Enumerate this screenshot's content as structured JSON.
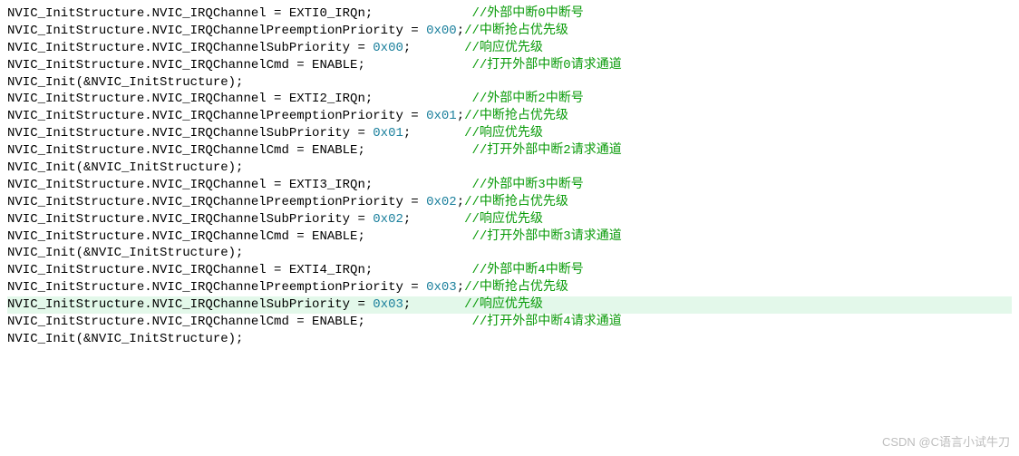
{
  "lines": [
    {
      "code": "NVIC_InitStructure.NVIC_IRQChannel = EXTI0_IRQn;             ",
      "comment": "//外部中断0中断号"
    },
    {
      "code": "NVIC_InitStructure.NVIC_IRQChannelPreemptionPriority = ",
      "num": "0x00",
      "tail": ";",
      "comment": "//中断抢占优先级"
    },
    {
      "code": "NVIC_InitStructure.NVIC_IRQChannelSubPriority = ",
      "num": "0x00",
      "tail": ";       ",
      "comment": "//响应优先级"
    },
    {
      "code": "NVIC_InitStructure.NVIC_IRQChannelCmd = ENABLE;              ",
      "comment": "//打开外部中断0请求通道"
    },
    {
      "code": "NVIC_Init(&NVIC_InitStructure);"
    },
    {
      "code": ""
    },
    {
      "code": "NVIC_InitStructure.NVIC_IRQChannel = EXTI2_IRQn;             ",
      "comment": "//外部中断2中断号"
    },
    {
      "code": "NVIC_InitStructure.NVIC_IRQChannelPreemptionPriority = ",
      "num": "0x01",
      "tail": ";",
      "comment": "//中断抢占优先级"
    },
    {
      "code": "NVIC_InitStructure.NVIC_IRQChannelSubPriority = ",
      "num": "0x01",
      "tail": ";       ",
      "comment": "//响应优先级"
    },
    {
      "code": "NVIC_InitStructure.NVIC_IRQChannelCmd = ENABLE;              ",
      "comment": "//打开外部中断2请求通道"
    },
    {
      "code": "NVIC_Init(&NVIC_InitStructure);"
    },
    {
      "code": ""
    },
    {
      "code": ""
    },
    {
      "code": "NVIC_InitStructure.NVIC_IRQChannel = EXTI3_IRQn;             ",
      "comment": "//外部中断3中断号"
    },
    {
      "code": "NVIC_InitStructure.NVIC_IRQChannelPreemptionPriority = ",
      "num": "0x02",
      "tail": ";",
      "comment": "//中断抢占优先级"
    },
    {
      "code": "NVIC_InitStructure.NVIC_IRQChannelSubPriority = ",
      "num": "0x02",
      "tail": ";       ",
      "comment": "//响应优先级"
    },
    {
      "code": "NVIC_InitStructure.NVIC_IRQChannelCmd = ENABLE;              ",
      "comment": "//打开外部中断3请求通道"
    },
    {
      "code": "NVIC_Init(&NVIC_InitStructure);"
    },
    {
      "code": ""
    },
    {
      "code": "NVIC_InitStructure.NVIC_IRQChannel = EXTI4_IRQn;             ",
      "comment": "//外部中断4中断号"
    },
    {
      "code": "NVIC_InitStructure.NVIC_IRQChannelPreemptionPriority = ",
      "num": "0x03",
      "tail": ";",
      "comment": "//中断抢占优先级"
    },
    {
      "code": "NVIC_InitStructure.NVIC_IRQChannelSubPriority = ",
      "num": "0x03",
      "tail": ";       ",
      "comment": "//响应优先级",
      "hl": true
    },
    {
      "code": "NVIC_InitStructure.NVIC_IRQChannelCmd = ENABLE;              ",
      "comment": "//打开外部中断4请求通道"
    },
    {
      "code": "NVIC_Init(&NVIC_InitStructure);"
    }
  ],
  "watermark": "CSDN @C语言小试牛刀"
}
